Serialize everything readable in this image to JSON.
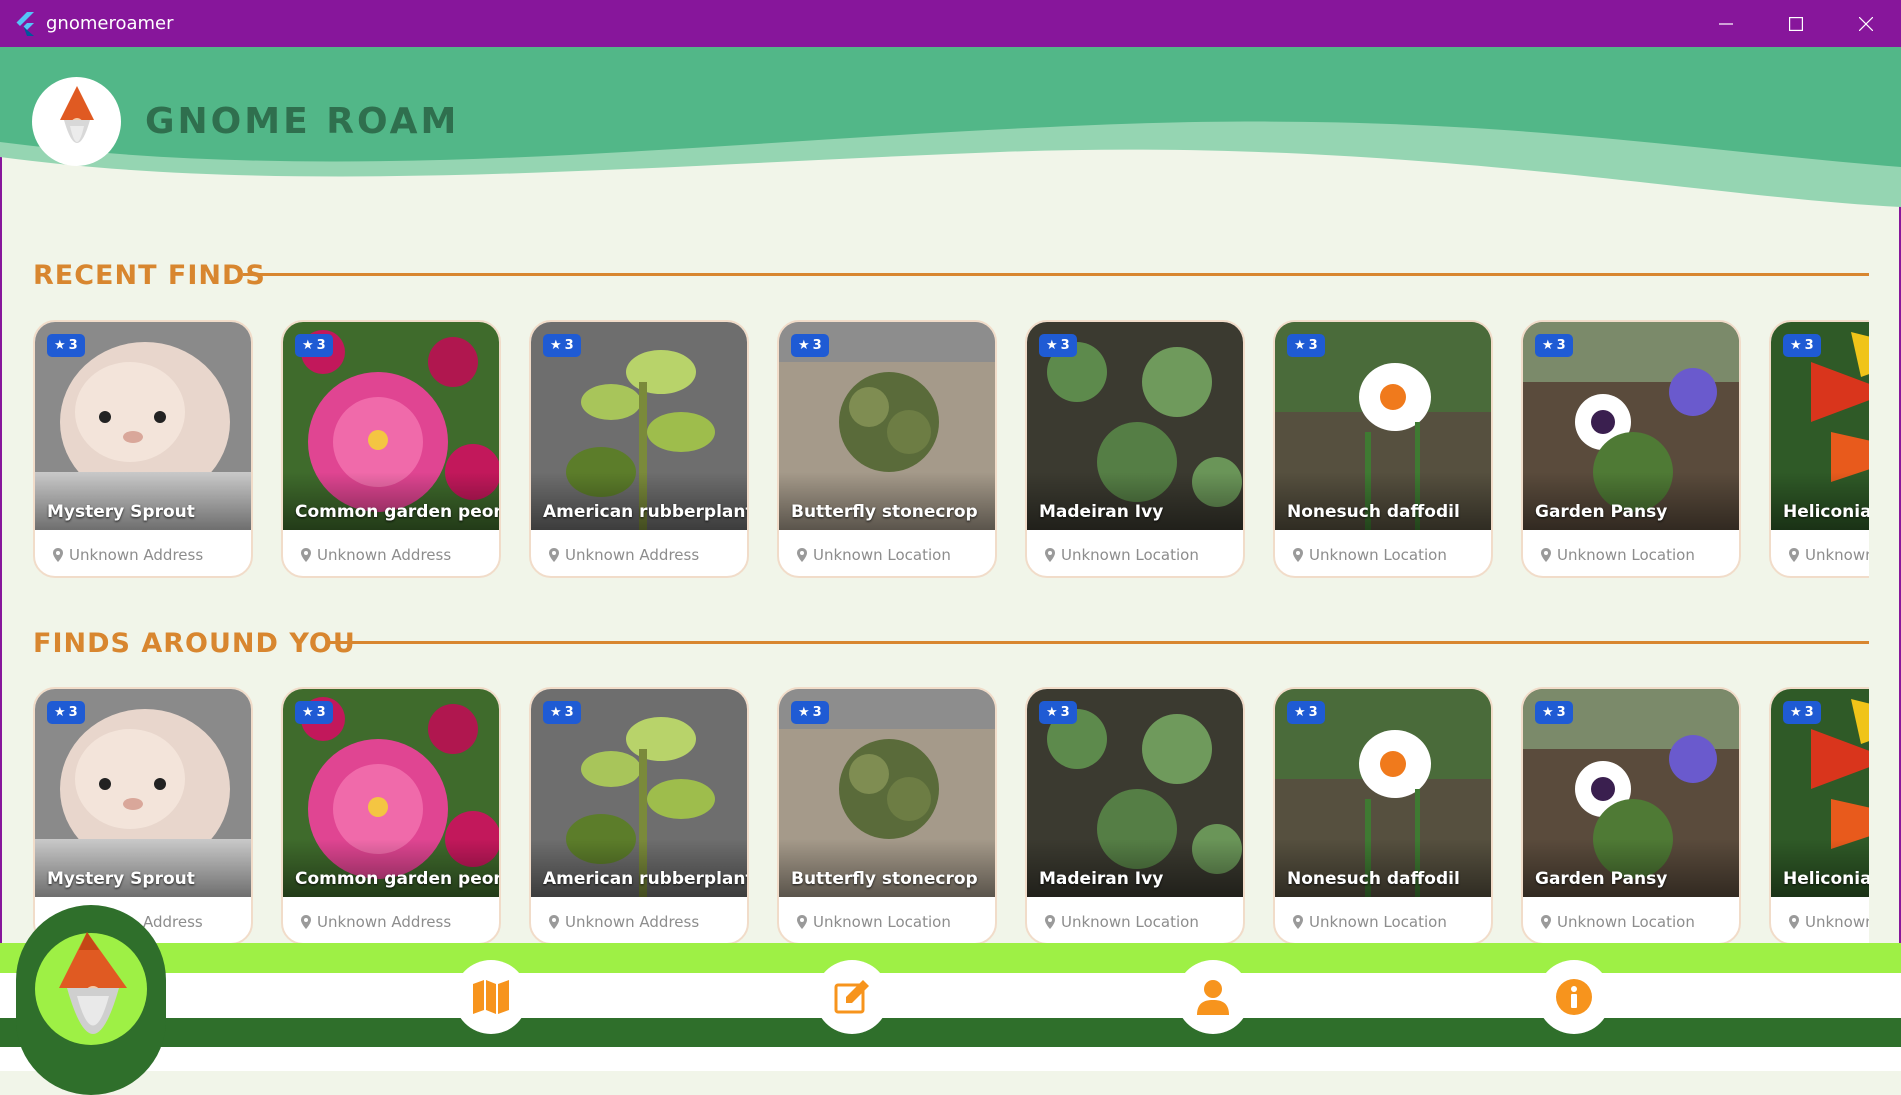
{
  "window": {
    "title": "gnomeroamer",
    "controls": [
      "minimize-icon",
      "maximize-icon",
      "close-icon"
    ]
  },
  "header": {
    "brand": "GNOME ROAM",
    "logo_icon": "gnome-icon"
  },
  "colors": {
    "titlebar": "#87169b",
    "header_green": "#52b788",
    "header_light": "#95d5b2",
    "section_orange": "#d8862f",
    "badge_blue": "#1f5bd4",
    "nav_lime": "#9ef045",
    "nav_dark": "#2f6f2b",
    "icon_orange": "#f7941d"
  },
  "sections": [
    {
      "title": "RECENT FINDS",
      "cards": [
        {
          "rating": "3",
          "name": "Mystery Sprout",
          "location": "Unknown Address"
        },
        {
          "rating": "3",
          "name": "Common garden peony",
          "location": "Unknown Address"
        },
        {
          "rating": "3",
          "name": "American rubberplant",
          "location": "Unknown Address"
        },
        {
          "rating": "3",
          "name": "Butterfly stonecrop",
          "location": "Unknown Location"
        },
        {
          "rating": "3",
          "name": "Madeiran Ivy",
          "location": "Unknown Location"
        },
        {
          "rating": "3",
          "name": "Nonesuch daffodil",
          "location": "Unknown Location"
        },
        {
          "rating": "3",
          "name": "Garden Pansy",
          "location": "Unknown Location"
        },
        {
          "rating": "3",
          "name": "Heliconia m",
          "location": "Unknown"
        }
      ]
    },
    {
      "title": "FINDS AROUND YOU",
      "cards": [
        {
          "rating": "3",
          "name": "Mystery Sprout",
          "location": "Address"
        },
        {
          "rating": "3",
          "name": "Common garden peony",
          "location": "Unknown Address"
        },
        {
          "rating": "3",
          "name": "American rubberplant",
          "location": "Unknown Address"
        },
        {
          "rating": "3",
          "name": "Butterfly stonecrop",
          "location": "Unknown Location"
        },
        {
          "rating": "3",
          "name": "Madeiran Ivy",
          "location": "Unknown Location"
        },
        {
          "rating": "3",
          "name": "Nonesuch daffodil",
          "location": "Unknown Location"
        },
        {
          "rating": "3",
          "name": "Garden Pansy",
          "location": "Unknown Location"
        },
        {
          "rating": "3",
          "name": "Heliconia m",
          "location": "Unknown"
        }
      ]
    }
  ],
  "nav": {
    "items": [
      {
        "icon": "gnome-home-icon"
      },
      {
        "icon": "map-icon"
      },
      {
        "icon": "edit-icon"
      },
      {
        "icon": "profile-icon"
      },
      {
        "icon": "info-icon"
      }
    ]
  }
}
